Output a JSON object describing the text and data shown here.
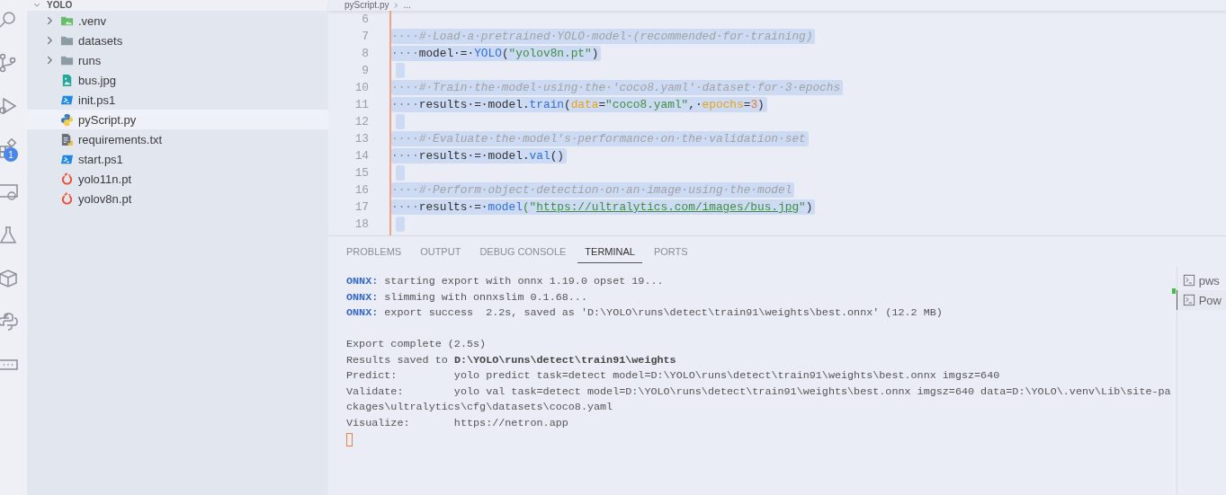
{
  "activity_bar": {
    "badge": "1"
  },
  "explorer": {
    "title": "YOLO",
    "expanded": true,
    "items": [
      {
        "label": ".venv",
        "kind": "venv",
        "expanded": false,
        "selected": false
      },
      {
        "label": "datasets",
        "kind": "folder",
        "expanded": false,
        "selected": false
      },
      {
        "label": "runs",
        "kind": "folder",
        "expanded": false,
        "selected": false
      },
      {
        "label": "bus.jpg",
        "kind": "image",
        "selected": false
      },
      {
        "label": "init.ps1",
        "kind": "script",
        "selected": false
      },
      {
        "label": "pyScript.py",
        "kind": "python",
        "selected": true
      },
      {
        "label": "requirements.txt",
        "kind": "text",
        "selected": false
      },
      {
        "label": "start.ps1",
        "kind": "script",
        "selected": false
      },
      {
        "label": "yolo11n.pt",
        "kind": "model",
        "selected": false
      },
      {
        "label": "yolov8n.pt",
        "kind": "model",
        "selected": false
      }
    ]
  },
  "editor": {
    "breadcrumb": [
      "pyScript.py",
      "..."
    ],
    "lines": [
      {
        "number": "6",
        "selected": false
      },
      {
        "number": "7",
        "selected": true,
        "tokens": [
          {
            "text": "····#·Load·a·pretrained·YOLO·model·(recommended·for·training)",
            "kind": "comment"
          }
        ]
      },
      {
        "number": "8",
        "selected": true,
        "tokens": [
          {
            "text": "····",
            "kind": "ws"
          },
          {
            "text": "model·=·",
            "kind": "plain"
          },
          {
            "text": "YOLO",
            "kind": "func"
          },
          {
            "text": "(",
            "kind": "plain"
          },
          {
            "text": "\"yolov8n.pt\"",
            "kind": "string"
          },
          {
            "text": ")",
            "kind": "plain"
          }
        ]
      },
      {
        "number": "9",
        "selected": true
      },
      {
        "number": "10",
        "selected": true,
        "tokens": [
          {
            "text": "····#·Train·the·model·using·the·'coco8.yaml'·dataset·for·3·epochs",
            "kind": "comment"
          }
        ]
      },
      {
        "number": "11",
        "selected": true,
        "tokens": [
          {
            "text": "····",
            "kind": "ws"
          },
          {
            "text": "results·=·model.",
            "kind": "plain"
          },
          {
            "text": "train",
            "kind": "func"
          },
          {
            "text": "(",
            "kind": "plain"
          },
          {
            "text": "data",
            "kind": "param"
          },
          {
            "text": "=",
            "kind": "plain"
          },
          {
            "text": "\"coco8.yaml\"",
            "kind": "string"
          },
          {
            "text": ",·",
            "kind": "plain"
          },
          {
            "text": "epochs",
            "kind": "param"
          },
          {
            "text": "=",
            "kind": "plain"
          },
          {
            "text": "3",
            "kind": "number"
          },
          {
            "text": ")",
            "kind": "plain"
          }
        ]
      },
      {
        "number": "12",
        "selected": true
      },
      {
        "number": "13",
        "selected": true,
        "tokens": [
          {
            "text": "····#·Evaluate·the·model's·performance·on·the·validation·set",
            "kind": "comment"
          }
        ]
      },
      {
        "number": "14",
        "selected": true,
        "tokens": [
          {
            "text": "····",
            "kind": "ws"
          },
          {
            "text": "results·=·model.",
            "kind": "plain"
          },
          {
            "text": "val",
            "kind": "func"
          },
          {
            "text": "()",
            "kind": "plain"
          }
        ]
      },
      {
        "number": "15",
        "selected": true
      },
      {
        "number": "16",
        "selected": true,
        "tokens": [
          {
            "text": "····#·Perform·object·detection·on·an·image·using·the·model",
            "kind": "comment"
          }
        ]
      },
      {
        "number": "17",
        "selected": true,
        "tokens": [
          {
            "text": "····",
            "kind": "ws"
          },
          {
            "text": "results·=·",
            "kind": "plain"
          },
          {
            "text": "model",
            "kind": "func"
          },
          {
            "text": "(\"",
            "kind": "string"
          },
          {
            "text": "https://ultralytics.com/images/bus.jpg",
            "kind": "link"
          },
          {
            "text": "\"",
            "kind": "string"
          },
          {
            "text": ")",
            "kind": "plain"
          }
        ]
      },
      {
        "number": "18",
        "selected": true
      }
    ]
  },
  "panel": {
    "tabs": [
      {
        "label": "PROBLEMS",
        "selected": false
      },
      {
        "label": "OUTPUT",
        "selected": false
      },
      {
        "label": "DEBUG CONSOLE",
        "selected": false
      },
      {
        "label": "TERMINAL",
        "selected": true
      },
      {
        "label": "PORTS",
        "selected": false
      }
    ],
    "terminal": {
      "cursor": true,
      "lines": [
        {
          "segments": [
            {
              "text": "ONNX:",
              "kind": "label"
            },
            {
              "text": " starting export with onnx 1.19.0 opset 19...",
              "kind": "plain"
            }
          ]
        },
        {
          "segments": [
            {
              "text": "ONNX:",
              "kind": "label"
            },
            {
              "text": " slimming with onnxslim 0.1.68...",
              "kind": "plain"
            }
          ]
        },
        {
          "segments": [
            {
              "text": "ONNX:",
              "kind": "label"
            },
            {
              "text": " export success  2.2s, saved as 'D:\\YOLO\\runs\\detect\\train91\\weights\\best.onnx' (12.2 MB)",
              "kind": "plain"
            }
          ]
        },
        {
          "gap_before": true,
          "segments": [
            {
              "text": "Export complete (2.5s)",
              "kind": "plain"
            }
          ]
        },
        {
          "segments": [
            {
              "text": "Results saved to ",
              "kind": "plain"
            },
            {
              "text": "D:\\YOLO\\runs\\detect\\train91\\weights",
              "kind": "bold"
            }
          ]
        },
        {
          "segments": [
            {
              "text": "Predict:         yolo predict task=detect model=D:\\YOLO\\runs\\detect\\train91\\weights\\best.onnx imgsz=640",
              "kind": "plain"
            }
          ]
        },
        {
          "segments": [
            {
              "text": "Validate:        yolo val task=detect model=D:\\YOLO\\runs\\detect\\train91\\weights\\best.onnx imgsz=640 data=D:\\YOLO\\.venv\\Lib\\site-pa",
              "kind": "plain"
            }
          ]
        },
        {
          "segments": [
            {
              "text": "ckages\\ultralytics\\cfg\\datasets\\coco8.yaml",
              "kind": "plain"
            }
          ]
        },
        {
          "segments": [
            {
              "text": "Visualize:       https://netron.app",
              "kind": "plain"
            }
          ]
        }
      ]
    },
    "terminals": [
      {
        "label": "pws",
        "selected": false
      },
      {
        "label": "Pow",
        "selected": true
      }
    ]
  }
}
